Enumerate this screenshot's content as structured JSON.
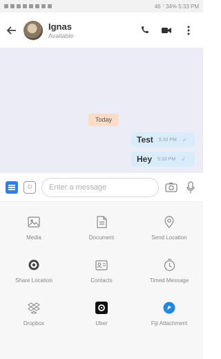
{
  "status_bar": {
    "right_text": "46 ⁷ 34% 5:33 PM"
  },
  "header": {
    "contact_name": "Ignas",
    "contact_status": "Available"
  },
  "chat": {
    "date_label": "Today",
    "messages": [
      {
        "text": "Test",
        "time": "5:33 PM"
      },
      {
        "text": "Hey",
        "time": "5:33 PM"
      }
    ]
  },
  "composer": {
    "placeholder": "Enter a message"
  },
  "attachments": [
    {
      "label": "Media",
      "icon": "image-icon"
    },
    {
      "label": "Document",
      "icon": "document-icon"
    },
    {
      "label": "Send Location",
      "icon": "location-pin-icon"
    },
    {
      "label": "Share Location",
      "icon": "share-location-icon"
    },
    {
      "label": "Contacts",
      "icon": "contact-card-icon"
    },
    {
      "label": "Timed Message",
      "icon": "timer-icon"
    },
    {
      "label": "Dropbox",
      "icon": "dropbox-icon"
    },
    {
      "label": "Uber",
      "icon": "uber-icon"
    },
    {
      "label": "Fiji Attachment",
      "icon": "fiji-icon"
    }
  ],
  "colors": {
    "accent": "#2d7ff0",
    "chat_bg": "#ebecf6",
    "outgoing_bubble": "#d9ecfa",
    "date_chip": "#fadcc8"
  }
}
